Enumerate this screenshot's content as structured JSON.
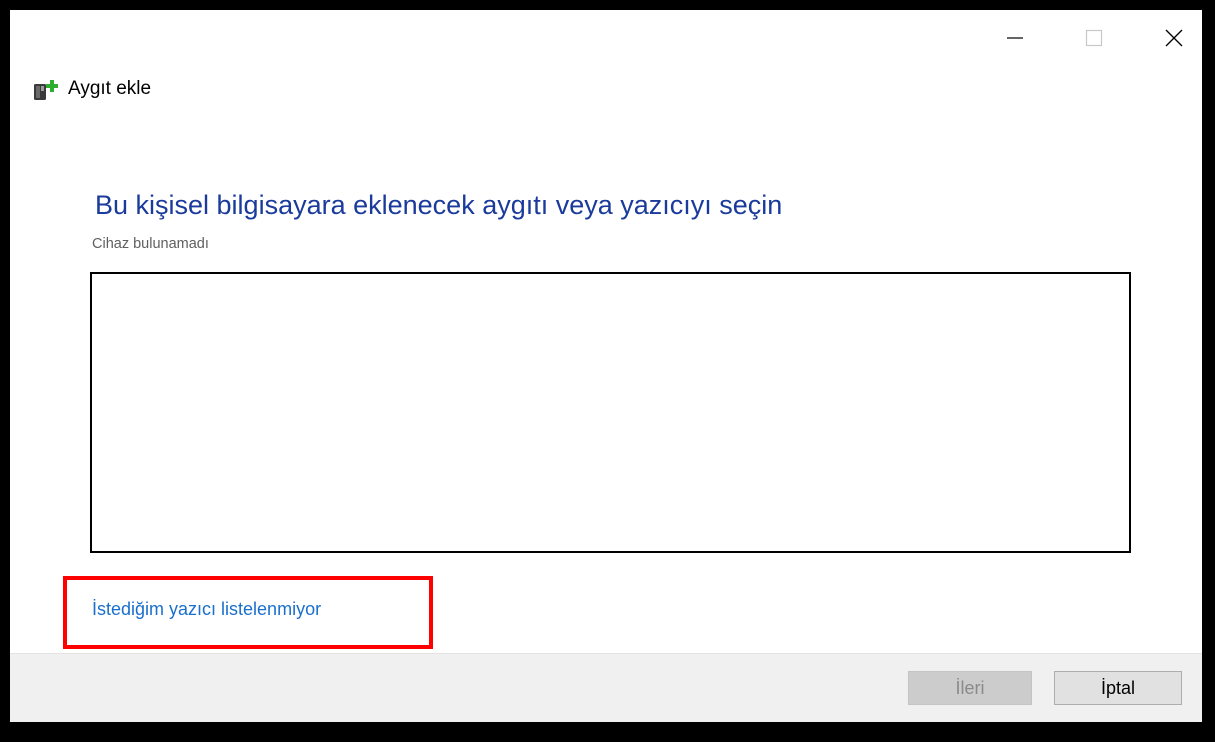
{
  "window": {
    "title": "Aygıt ekle",
    "controls": {
      "minimize": "minimize-icon",
      "maximize": "maximize-icon",
      "close": "close-icon"
    }
  },
  "main": {
    "heading": "Bu kişisel bilgisayara eklenecek aygıtı veya yazıcıyı seçin",
    "status": "Cihaz bulunamadı",
    "device_list": []
  },
  "link": {
    "label": "İstediğim yazıcı listelenmiyor"
  },
  "footer": {
    "next_label": "İleri",
    "cancel_label": "İptal"
  },
  "colors": {
    "heading": "#1a3a9c",
    "link": "#1a6fcc",
    "highlight": "#ff0000",
    "footer_bg": "#f0f0f0"
  }
}
